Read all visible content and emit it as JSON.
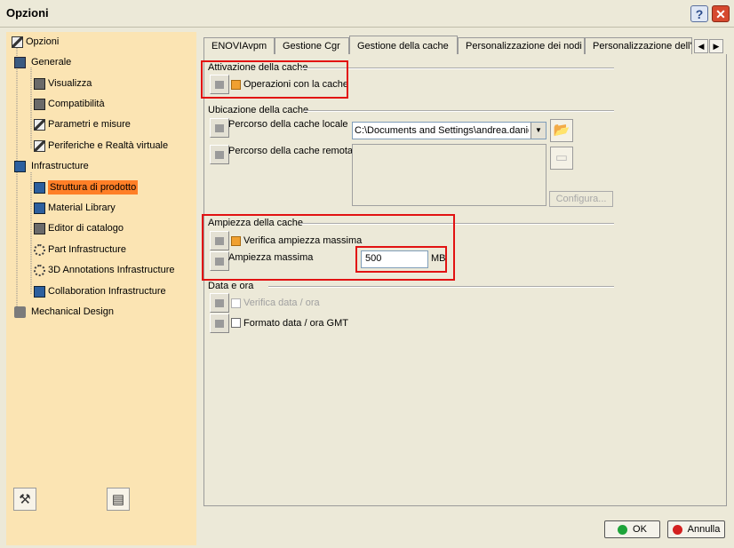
{
  "window": {
    "title": "Opzioni",
    "help_label": "?",
    "close_label": "✕"
  },
  "tree": {
    "root": "Opzioni",
    "items": [
      {
        "label": "Generale",
        "icon": "chip-icon"
      },
      {
        "label": "Visualizza",
        "icon": "display-icon"
      },
      {
        "label": "Compatibilità",
        "icon": "compatibility-icon"
      },
      {
        "label": "Parametri e misure",
        "icon": "parameters-icon"
      },
      {
        "label": "Periferiche e Realtà virtuale",
        "icon": "devices-icon"
      },
      {
        "label": "Infrastructure",
        "icon": "infrastructure-icon"
      },
      {
        "label": "Struttura di prodotto",
        "icon": "product-structure-icon",
        "selected": true
      },
      {
        "label": "Material Library",
        "icon": "material-library-icon"
      },
      {
        "label": "Editor di catalogo",
        "icon": "catalog-editor-icon"
      },
      {
        "label": "Part Infrastructure",
        "icon": "part-gear-icon"
      },
      {
        "label": "3D Annotations Infrastructure",
        "icon": "annotations-icon"
      },
      {
        "label": "Collaboration Infrastructure",
        "icon": "collaboration-icon"
      },
      {
        "label": "Mechanical Design",
        "icon": "mechanical-design-icon"
      }
    ]
  },
  "tabs": [
    {
      "label": "ENOVIAvpm"
    },
    {
      "label": "Gestione Cgr"
    },
    {
      "label": "Gestione della cache",
      "active": true
    },
    {
      "label": "Personalizzazione dei nodi"
    },
    {
      "label": "Personalizzazione dell'a"
    }
  ],
  "cache_activation": {
    "group_label": "Attivazione della cache",
    "checkbox_label": "Operazioni con la cache",
    "checked": true
  },
  "cache_location": {
    "group_label": "Ubicazione della cache",
    "local_label": "Percorso della cache locale",
    "local_path": "C:\\Documents and Settings\\andrea.danie",
    "remote_label": "Percorso della cache remota",
    "configure_label": "Configura..."
  },
  "cache_size": {
    "group_label": "Ampiezza della cache",
    "check_label": "Verifica ampiezza massima",
    "checked": true,
    "max_label": "Ampiezza massima",
    "max_value": "500",
    "unit": "MB"
  },
  "date_time": {
    "group_label": "Data e ora",
    "verify_label": "Verifica data / ora",
    "gmt_label": "Formato data / ora GMT"
  },
  "footer": {
    "ok_label": "OK",
    "cancel_label": "Annulla"
  },
  "colors": {
    "highlight": "#e21212",
    "tree_bg": "#fbe4b3",
    "selection": "#ff7f27"
  }
}
